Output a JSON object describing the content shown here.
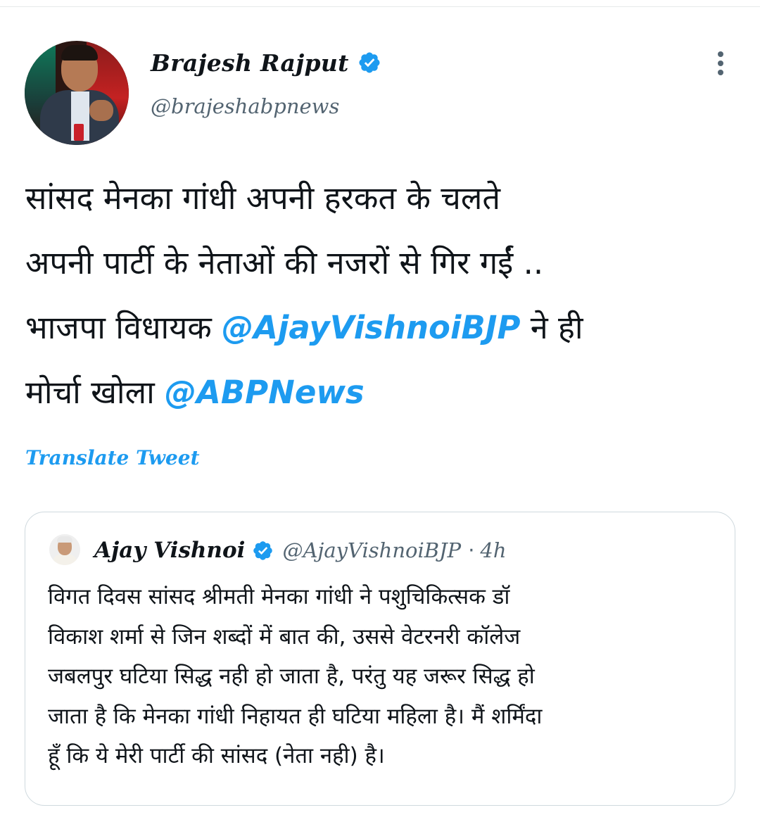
{
  "tweet": {
    "author": {
      "display_name": "Brajesh Rajput",
      "handle": "@brajeshabpnews",
      "verified": true
    },
    "more_icon": "more-vertical-icon",
    "body": {
      "line1": "सांसद मेनका गांधी अपनी हरकत के चलते",
      "line2": "अपनी पार्टी के नेताओं की नजरों से गिर गईं ..",
      "line3_pre": "भाजपा विधायक ",
      "line3_mention": "@AjayVishnoiBJP",
      "line3_post": " ने ही",
      "line4_pre": "मोर्चा खोला ",
      "line4_mention": "@ABPNews"
    },
    "translate_label": "Translate Tweet"
  },
  "quoted_tweet": {
    "display_name": "Ajay Vishnoi",
    "handle": "@AjayVishnoiBJP",
    "separator": "·",
    "time": "4h",
    "verified": true,
    "lines": [
      "विगत दिवस सांसद श्रीमती मेनका गांधी ने पशुचिकित्सक डॉ",
      "विकाश शर्मा से जिन शब्दों में बात की, उससे वेटरनरी कॉलेज",
      "जबलपुर घटिया सिद्ध नही हो जाता है, परंतु यह जरूर सिद्ध हो",
      "जाता है कि मेनका गांधी निहायत ही घटिया महिला है। मैं शर्मिंदा",
      "हूँ कि ये मेरी पार्टी की सांसद (नेता नही) है।"
    ]
  },
  "colors": {
    "accent": "#1d9bf0",
    "text_primary": "#0f1419",
    "text_secondary": "#536471",
    "border": "#cfd9de"
  }
}
